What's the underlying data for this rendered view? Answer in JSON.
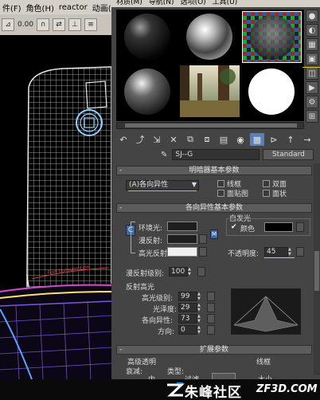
{
  "viewport": {
    "menubar": [
      "件(F)",
      "角色(H)",
      "reactor",
      "动画(A)"
    ],
    "toolbar_value": "0.00",
    "wire_tag": "Fuel consumption"
  },
  "editor": {
    "menubar": [
      "材质(M)",
      "导航(N)",
      "选项(O)",
      "工具(U)"
    ],
    "material_name": "SJ--G",
    "material_type": "Standard",
    "rollouts": {
      "shader_basic": "明暗器基本参数",
      "anisotropic_basic": "各向异性基本参数",
      "extended": "扩展参数"
    },
    "shader": {
      "selected": "(A)各向异性",
      "options": [
        {
          "label": "线框",
          "checked": false
        },
        {
          "label": "双面",
          "checked": false
        },
        {
          "label": "面贴图",
          "checked": false
        },
        {
          "label": "面状",
          "checked": false
        }
      ]
    },
    "colors": {
      "ambient_label": "环境光:",
      "diffuse_label": "漫反射:",
      "specular_label": "高光反射:",
      "ambient": "#1e1e1e",
      "diffuse": "#1e1e1e",
      "specular": "#f0f0f0",
      "lock_letter": "C",
      "map_letter": "M"
    },
    "self_illum": {
      "title": "自发光",
      "color_label": "颜色",
      "color_checked": true,
      "color": "#000000"
    },
    "opacity": {
      "label": "不透明度:",
      "value": "45"
    },
    "diffuse_level": {
      "label": "漫反射级别:",
      "value": "100"
    },
    "specular_highlights": {
      "title": "反射高光",
      "fields": [
        {
          "label": "高光级别:",
          "value": "99"
        },
        {
          "label": "光泽度:",
          "value": "29"
        },
        {
          "label": "各向异性:",
          "value": "73"
        },
        {
          "label": "方向:",
          "value": "0"
        }
      ]
    },
    "extended_params": {
      "advanced_transparency": "高级透明",
      "falloff": "衰减:",
      "type": "类型:",
      "inner": "内",
      "filter": "过滤",
      "wire": "线框",
      "size": "大小"
    }
  },
  "watermark": {
    "brand": "朱峰社区",
    "domain": "ZF3D.COM"
  }
}
